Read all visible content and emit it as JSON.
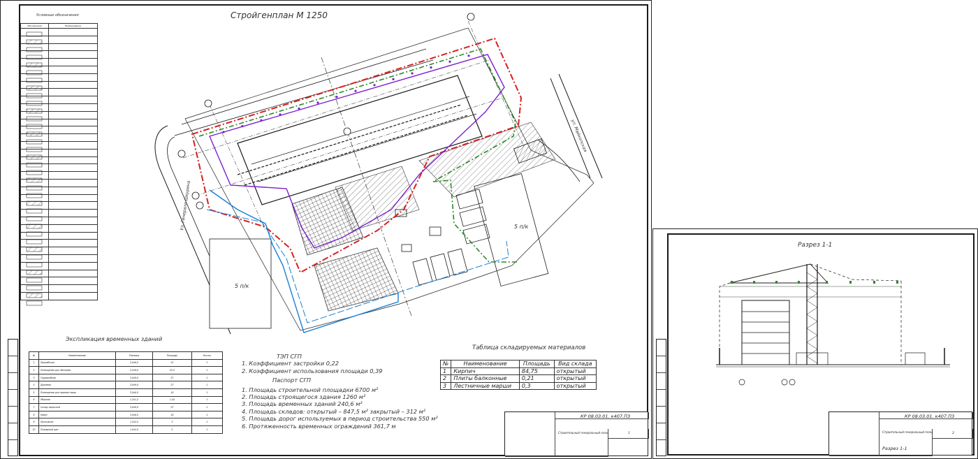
{
  "sheet1": {
    "title": "Стройгенплан М 1250",
    "legend": {
      "title": "Условные обозначения",
      "headers": [
        "Обозначение",
        "Наименование"
      ]
    },
    "labels": {
      "road_left": "Ул. Генерала Шкурина",
      "road_right": "ул. Майкопская",
      "bp_right": "5 п/к",
      "bp_left": "5 п/к"
    },
    "explication": {
      "title": "Экспликация временных зданий",
      "headers": [
        "№",
        "Наименование",
        "Размеры",
        "Площадь",
        "Кол-во"
      ],
      "rows": [
        [
          "1",
          "Прорабская",
          "2,0х6,0",
          "12",
          "1"
        ],
        [
          "2",
          "Помещение для обогрева",
          "2,5х9,0",
          "22,5",
          "1"
        ],
        [
          "3",
          "Гардеробная",
          "3,0х9,0",
          "27",
          "1"
        ],
        [
          "4",
          "Душевая",
          "3,0х9,0",
          "27",
          "1"
        ],
        [
          "5",
          "Помещение для приема пищи",
          "3,0х6,0",
          "18",
          "1"
        ],
        [
          "6",
          "Уборная",
          "1,2х1,2",
          "1,44",
          "1"
        ],
        [
          "7",
          "Склад закрытый",
          "3,0х9,0",
          "27",
          "1"
        ],
        [
          "8",
          "Навес",
          "3,0х6,0",
          "18",
          "1"
        ],
        [
          "9",
          "Проходная",
          "1,5х2,0",
          "3",
          "1"
        ],
        [
          "10",
          "Пожарный щит",
          "1,0х2,0",
          "2",
          "1"
        ]
      ]
    },
    "tep": {
      "head1": "ТЭП СГП",
      "items1": [
        "1. Коэффициент застройки 0,22",
        "2. Коэффициент использования площади 0,39"
      ],
      "head2": "Паспорт СГП",
      "items2": [
        "1. Площадь строительной площадки 6700 м²",
        "2. Площадь строящегося здания 1260 м²",
        "3. Площадь временных зданий 240,6 м²",
        "4. Площадь складов: открытый – 847,5 м² закрытый – 312 м²",
        "5. Площадь дорог используемых в период строительства 550 м²",
        "6. Протяженность временных ограждений 361,7 м"
      ]
    },
    "materials": {
      "title": "Таблица складируемых материалов",
      "headers": [
        "№",
        "Наименование",
        "Площадь",
        "Вид склада"
      ],
      "rows": [
        [
          "1",
          "Кирпич",
          "84,75",
          "открытый"
        ],
        [
          "2",
          "Плиты балконные",
          "0,21",
          "открытый"
        ],
        [
          "3",
          "Лестничные марши",
          "0,3",
          "открытый"
        ]
      ]
    },
    "stamp": {
      "code": "КР 08.03.01. к407.ПЗ",
      "title": "Строительный генеральный план",
      "sheet": "1"
    }
  },
  "sheet2": {
    "title": "Разрез 1-1",
    "stamp": {
      "code": "КР 08.03.01. к407.ПЗ",
      "title": "Строительный генеральный план",
      "subtitle": "Разрез 1-1",
      "sheet": "2"
    }
  },
  "colors": {
    "fence": "#d62020",
    "crane_zone": "#7c1fd1",
    "danger_zone": "#2a8a2a",
    "water": "#1a7fd4",
    "line": "#1a1a1a"
  }
}
